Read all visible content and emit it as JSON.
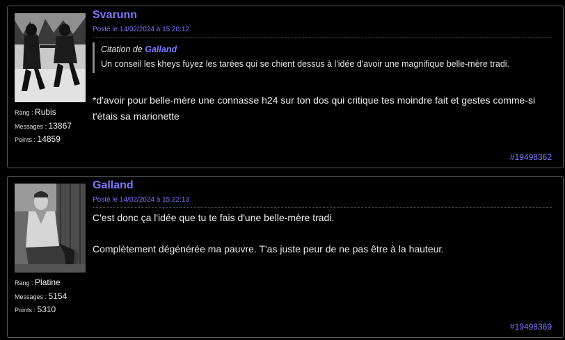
{
  "posts": [
    {
      "author": "Svarunn",
      "date": "Posté le 14/02/2024 à 15:20:12",
      "stats": [
        {
          "label": "Rang",
          "value": "Rubis"
        },
        {
          "label": "Messages",
          "value": "13867"
        },
        {
          "label": "Points",
          "value": "14859"
        }
      ],
      "quote": {
        "prefix": "Citation de",
        "author": "Galland",
        "text": "Un conseil les kheys fuyez les tarées qui se chient dessus à l'idée d'avoir une magnifique belle-mère tradi."
      },
      "body": [
        "*d'avoir pour belle-mère une connasse h24 sur ton dos qui critique tes moindre fait et gestes comme-si t'étais sa marionette"
      ],
      "message_id": "#19498362"
    },
    {
      "author": "Galland",
      "date": "Posté le 14/02/2024 à 15:22:13",
      "stats": [
        {
          "label": "Rang",
          "value": "Platine"
        },
        {
          "label": "Messages",
          "value": "5154"
        },
        {
          "label": "Points",
          "value": "5310"
        }
      ],
      "body": [
        "C'est donc ça l'idée que tu te fais d'une belle-mère tradi.",
        "Complètement dégénérée ma pauvre. T'as juste peur de ne pas être à la hauteur."
      ],
      "message_id": "#19498369"
    }
  ],
  "colors": {
    "accent": "#7b78ff",
    "background": "#000000",
    "border": "#5b5b5b"
  },
  "icons": [
    "avatar-couple-walking-in-snow",
    "avatar-man-sitting"
  ]
}
